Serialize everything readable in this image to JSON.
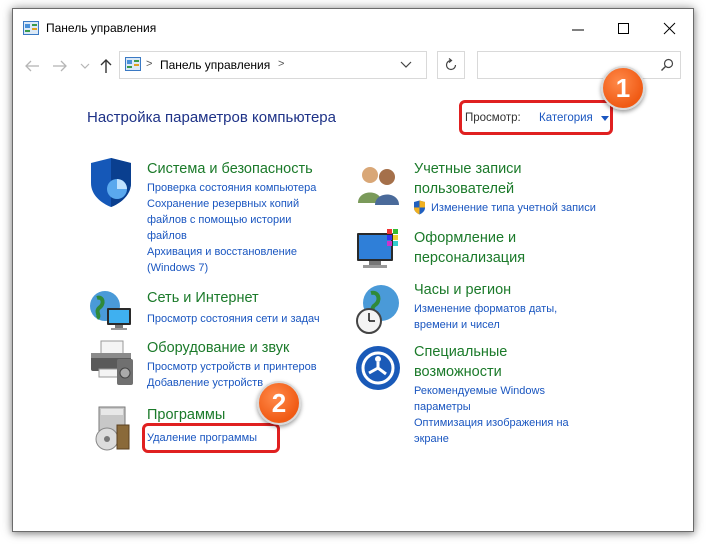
{
  "window": {
    "title": "Панель управления",
    "controls": {
      "minimize": "minimize-icon",
      "maximize": "maximize-icon",
      "close": "close-icon"
    }
  },
  "nav": {
    "breadcrumb": "Панель управления",
    "separator_start": ">",
    "separator_end": ">",
    "search_placeholder": ""
  },
  "header": {
    "title": "Настройка параметров компьютера",
    "view_label": "Просмотр:",
    "view_value": "Категория"
  },
  "callouts": {
    "first": "1",
    "second": "2"
  },
  "categories": {
    "system": {
      "title": "Система и безопасность",
      "links": [
        "Проверка состояния компьютера",
        "Сохранение резервных копий",
        "файлов с помощью истории",
        "файлов",
        "Архивация и восстановление",
        "(Windows 7)"
      ]
    },
    "network": {
      "title": "Сеть и Интернет",
      "links": [
        "Просмотр состояния сети и задач"
      ]
    },
    "hardware": {
      "title": "Оборудование и звук",
      "links": [
        "Просмотр устройств и принтеров",
        "Добавление устройств"
      ]
    },
    "programs": {
      "title": "Программы",
      "links": [
        "Удаление программы"
      ]
    },
    "accounts": {
      "title_line1": "Учетные записи",
      "title_line2": "пользователей",
      "links": [
        "Изменение типа учетной записи"
      ]
    },
    "appearance": {
      "title_line1": "Оформление и",
      "title_line2": "персонализация"
    },
    "clock": {
      "title": "Часы и регион",
      "links": [
        "Изменение форматов даты,",
        "времени и чисел"
      ]
    },
    "ease": {
      "title_line1": "Специальные",
      "title_line2": "возможности",
      "links": [
        "Рекомендуемые Windows",
        "параметры",
        "Оптимизация изображения на",
        "экране"
      ]
    }
  },
  "colors": {
    "category_title": "#1b7a2a",
    "link": "#1a56c0",
    "page_title": "#1e3287",
    "highlight": "#e02020",
    "callout": "#f05a14"
  }
}
